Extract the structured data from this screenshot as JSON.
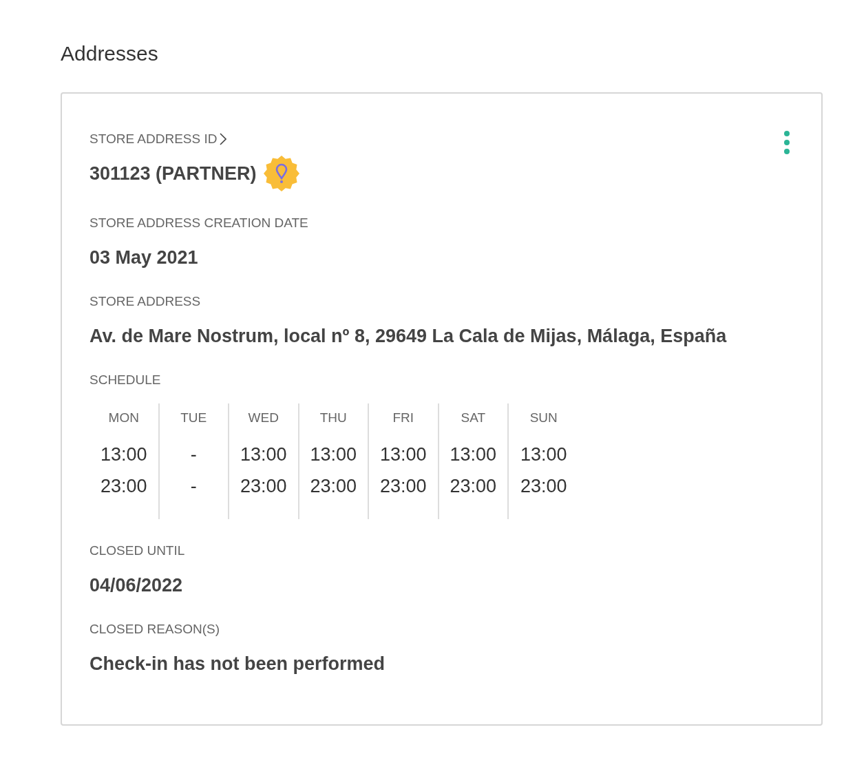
{
  "title": "Addresses",
  "card": {
    "sections": [
      {
        "kind": "id",
        "label": "STORE ADDRESS ID",
        "value": "301123 (PARTNER)"
      },
      {
        "kind": "text",
        "label": "STORE ADDRESS CREATION DATE",
        "value": "03 May 2021"
      },
      {
        "kind": "text",
        "label": "STORE ADDRESS",
        "value": "Av. de Mare Nostrum, local nº 8, 29649 La Cala de Mijas, Málaga, España"
      },
      {
        "kind": "schedule",
        "label": "SCHEDULE",
        "days": [
          {
            "day": "MON",
            "open": "13:00",
            "close": "23:00"
          },
          {
            "day": "TUE",
            "open": "-",
            "close": "-"
          },
          {
            "day": "WED",
            "open": "13:00",
            "close": "23:00"
          },
          {
            "day": "THU",
            "open": "13:00",
            "close": "23:00"
          },
          {
            "day": "FRI",
            "open": "13:00",
            "close": "23:00"
          },
          {
            "day": "SAT",
            "open": "13:00",
            "close": "23:00"
          },
          {
            "day": "SUN",
            "open": "13:00",
            "close": "23:00"
          }
        ]
      },
      {
        "kind": "text",
        "label": "CLOSED UNTIL",
        "value": "04/06/2022"
      },
      {
        "kind": "text",
        "label": "CLOSED REASON(S)",
        "value": "Check-in has not been performed"
      }
    ]
  }
}
